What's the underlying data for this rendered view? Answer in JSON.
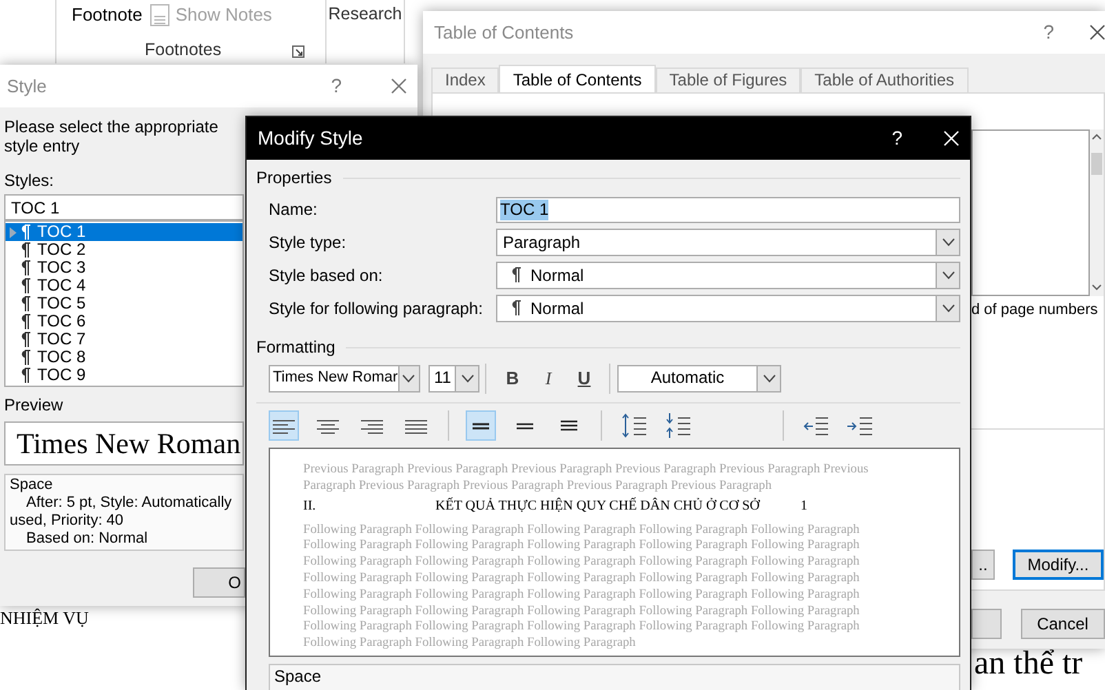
{
  "ribbon": {
    "buttons": [
      {
        "label": "Footnote",
        "disabled": false
      },
      {
        "label": "Show Notes",
        "disabled": true
      }
    ],
    "groups": [
      {
        "label": "Footnotes",
        "launcher": true
      },
      {
        "label": "Research",
        "launcher": false
      }
    ]
  },
  "document": {
    "heading_fragment": "NHIỆM VỤ",
    "body_fragment": "an thể tr"
  },
  "toc_dialog": {
    "title": "Table of Contents",
    "help": "?",
    "tabs": [
      {
        "label": "Index",
        "selected": false
      },
      {
        "label": "Table of Contents",
        "selected": true
      },
      {
        "label": "Table of Figures",
        "selected": false
      },
      {
        "label": "Table of Authorities",
        "selected": false
      }
    ],
    "option_fragment": "d of page numbers",
    "panel_buttons": [
      {
        "label": "..",
        "focused": false
      },
      {
        "label": "Modify...",
        "focused": true
      }
    ],
    "footer_buttons": [
      {
        "label": "Cancel",
        "focused": false
      }
    ]
  },
  "style_dialog": {
    "title": "Style",
    "help": "?",
    "prompt": "Please select the appropriate style entry",
    "styles_label": "Styles:",
    "style_value": "TOC 1",
    "styles": [
      {
        "label": "TOC 1",
        "selected": true
      },
      {
        "label": "TOC 2",
        "selected": false
      },
      {
        "label": "TOC 3",
        "selected": false
      },
      {
        "label": "TOC 4",
        "selected": false
      },
      {
        "label": "TOC 5",
        "selected": false
      },
      {
        "label": "TOC 6",
        "selected": false
      },
      {
        "label": "TOC 7",
        "selected": false
      },
      {
        "label": "TOC 8",
        "selected": false
      },
      {
        "label": "TOC 9",
        "selected": false
      }
    ],
    "preview_label": "Preview",
    "preview_text": "Times New Roman",
    "description": [
      "Space",
      "After:  5 pt, Style: Automatically",
      "used, Priority: 40",
      "Based on: Normal"
    ],
    "ok_button": "O"
  },
  "modify_dialog": {
    "title": "Modify Style",
    "help": "?",
    "properties_label": "Properties",
    "fields": [
      {
        "label": "Name:",
        "kind": "text",
        "value": "TOC 1",
        "text_selected": true
      },
      {
        "label": "Style type:",
        "kind": "select",
        "value": "Paragraph",
        "text_selected": false
      },
      {
        "label": "Style based on:",
        "kind": "style-select",
        "value": "Normal",
        "text_selected": false
      },
      {
        "label": "Style for following paragraph:",
        "kind": "style-select",
        "value": "Normal",
        "text_selected": false
      }
    ],
    "formatting_label": "Formatting",
    "font": "Times New Romar",
    "size": "11",
    "text_styles": [
      {
        "label": "B",
        "kind": "bold"
      },
      {
        "label": "I",
        "kind": "italic"
      },
      {
        "label": "U",
        "kind": "underline"
      }
    ],
    "font_color": "Automatic",
    "alignments": [
      {
        "kind": "left",
        "selected": true
      },
      {
        "kind": "center",
        "selected": false
      },
      {
        "kind": "right",
        "selected": false
      },
      {
        "kind": "justify",
        "selected": false
      }
    ],
    "line_spacings": [
      {
        "kind": "single",
        "selected": true
      },
      {
        "kind": "one-half",
        "selected": false
      },
      {
        "kind": "double",
        "selected": false
      }
    ],
    "preview": {
      "previous": "Previous Paragraph Previous Paragraph Previous Paragraph Previous Paragraph Previous Paragraph Previous Paragraph Previous Paragraph Previous Paragraph Previous Paragraph Previous Paragraph",
      "heading": {
        "number": "II.",
        "text": "KẾT QUẢ THỰC HIỆN QUY CHẾ DÂN CHỦ Ở CƠ SỞ",
        "page": "1"
      },
      "following": "Following Paragraph Following Paragraph Following Paragraph Following Paragraph Following Paragraph Following Paragraph Following Paragraph Following Paragraph Following Paragraph Following Paragraph Following Paragraph Following Paragraph Following Paragraph Following Paragraph Following Paragraph Following Paragraph Following Paragraph Following Paragraph Following Paragraph Following Paragraph Following Paragraph Following Paragraph Following Paragraph Following Paragraph Following Paragraph Following Paragraph Following Paragraph Following Paragraph Following Paragraph Following Paragraph Following Paragraph Following Paragraph Following Paragraph Following Paragraph Following Paragraph Following Paragraph Following Paragraph Following Paragraph"
    },
    "description": "Space"
  }
}
